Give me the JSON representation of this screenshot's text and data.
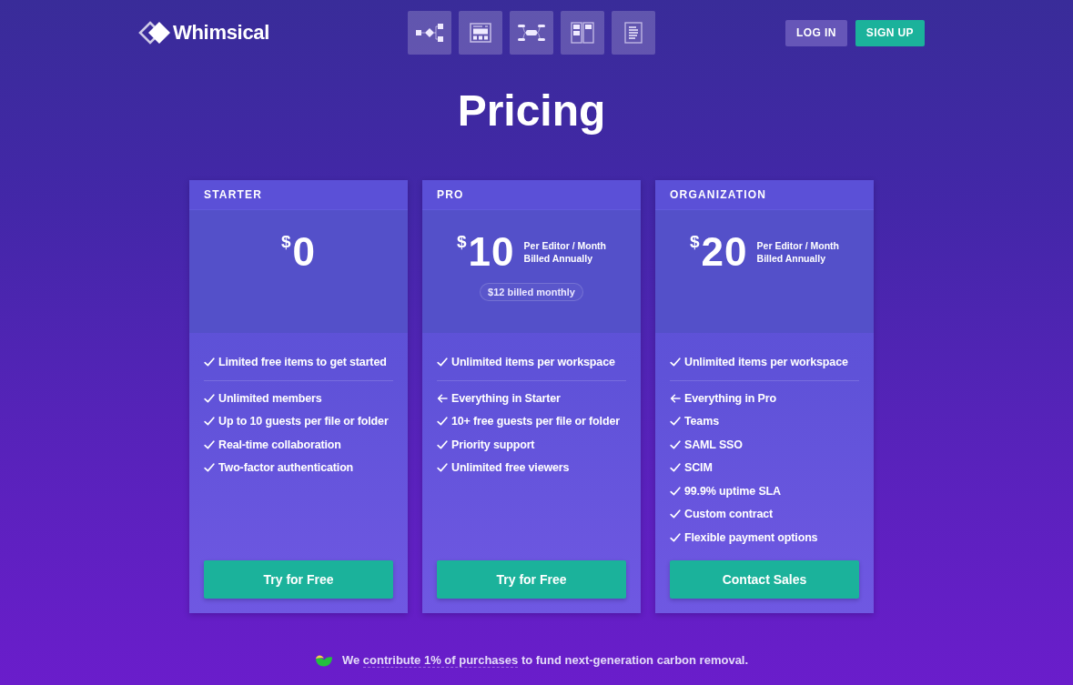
{
  "header": {
    "logo": "Whimsical",
    "auth_buttons": [
      {
        "kind": "secondary",
        "label": "LOG IN"
      },
      {
        "kind": "primary",
        "label": "SIGN UP"
      }
    ]
  },
  "title": "Pricing",
  "plans": [
    {
      "name": "STARTER",
      "currency": "$",
      "amount": "0",
      "headline": "Limited free items to get started",
      "features": [
        {
          "kind": "check",
          "text": "Unlimited members"
        },
        {
          "kind": "check",
          "text": "Up to 10 guests per file or folder"
        },
        {
          "kind": "check",
          "text": "Real-time collaboration"
        },
        {
          "kind": "check",
          "text": "Two-factor authentication"
        }
      ],
      "button": "Try for Free"
    },
    {
      "name": "PRO",
      "currency": "$",
      "amount": "10",
      "terms": [
        "Per Editor / Month",
        "Billed Annually"
      ],
      "monthly_note": "$12 billed monthly",
      "headline": "Unlimited items per workspace",
      "features": [
        {
          "kind": "inherit",
          "text": "Everything in Starter"
        },
        {
          "kind": "check",
          "text": "10+ free guests per file or folder"
        },
        {
          "kind": "check",
          "text": "Priority support"
        },
        {
          "kind": "check",
          "text": "Unlimited free viewers"
        }
      ],
      "button": "Try for Free"
    },
    {
      "name": "ORGANIZATION",
      "currency": "$",
      "amount": "20",
      "terms": [
        "Per Editor / Month",
        "Billed Annually"
      ],
      "headline": "Unlimited items per workspace",
      "features": [
        {
          "kind": "inherit",
          "text": "Everything in Pro"
        },
        {
          "kind": "check",
          "text": "Teams"
        },
        {
          "kind": "check",
          "text": "SAML SSO"
        },
        {
          "kind": "check",
          "text": "SCIM"
        },
        {
          "kind": "check",
          "text": "99.9% uptime SLA"
        },
        {
          "kind": "check",
          "text": "Custom contract"
        },
        {
          "kind": "check",
          "text": "Flexible payment options"
        }
      ],
      "button": "Contact Sales"
    }
  ],
  "footer": {
    "before": "We",
    "link": "contribute 1% of purchases",
    "after": "to fund next-generation carbon removal."
  }
}
